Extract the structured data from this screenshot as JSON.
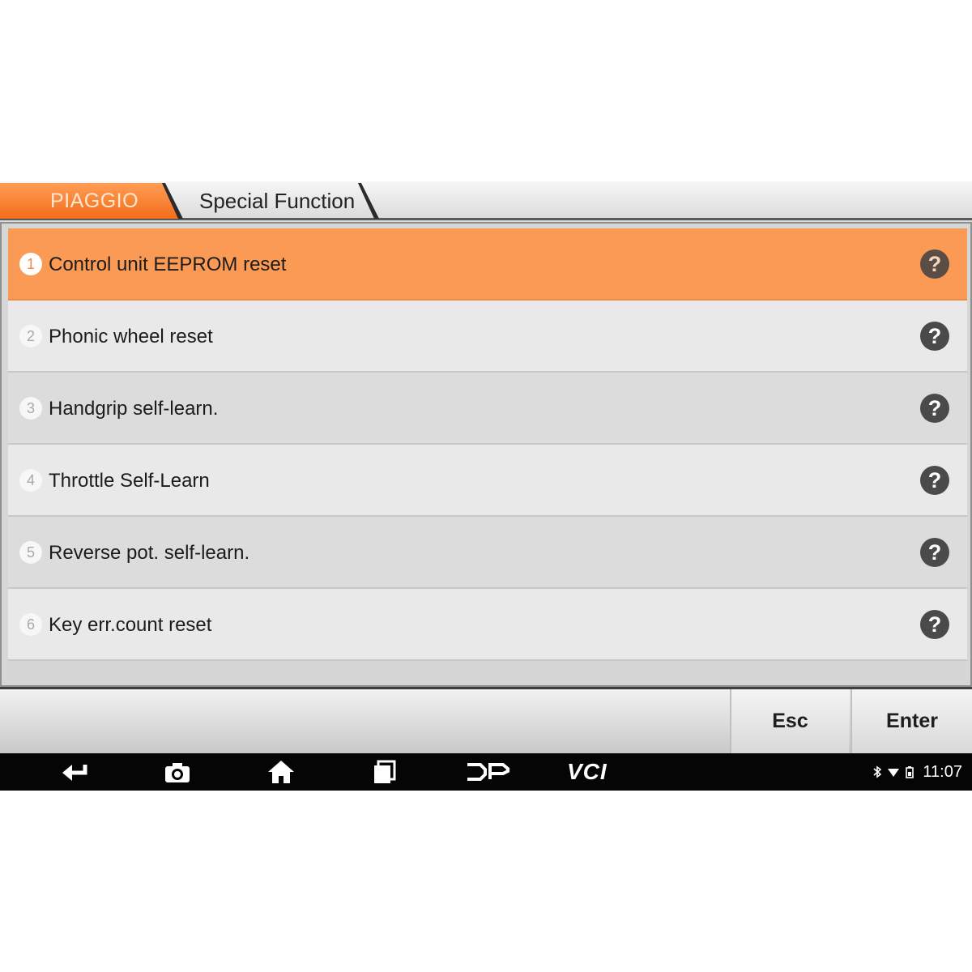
{
  "breadcrumb": {
    "brand": "PIAGGIO",
    "page": "Special Function"
  },
  "list": {
    "items": [
      {
        "num": "1",
        "label": "Control unit EEPROM reset",
        "selected": true
      },
      {
        "num": "2",
        "label": "Phonic wheel reset",
        "selected": false
      },
      {
        "num": "3",
        "label": "Handgrip self-learn.",
        "selected": false
      },
      {
        "num": "4",
        "label": "Throttle Self-Learn",
        "selected": false
      },
      {
        "num": "5",
        "label": "Reverse pot. self-learn.",
        "selected": false
      },
      {
        "num": "6",
        "label": "Key err.count reset",
        "selected": false
      }
    ],
    "help_icon": "?"
  },
  "actions": {
    "esc": "Esc",
    "enter": "Enter"
  },
  "navbar": {
    "icons": [
      "back-icon",
      "camera-icon",
      "home-icon",
      "recent-apps-icon",
      "dp-icon"
    ],
    "vci": "VCI"
  },
  "status": {
    "time": "11:07",
    "icons": [
      "bluetooth-icon",
      "wifi-icon",
      "battery-icon"
    ]
  },
  "colors": {
    "accent": "#f26d1a",
    "selected_row": "#fb9a55"
  }
}
